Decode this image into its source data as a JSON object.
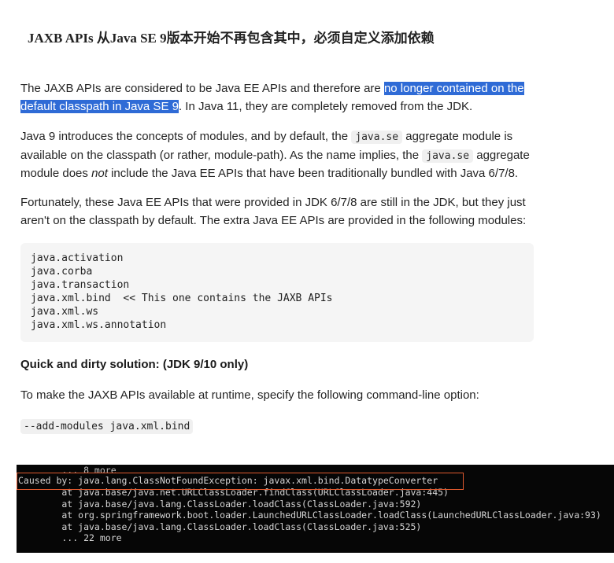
{
  "title": "JAXB APIs 从Java SE 9版本开始不再包含其中，必须自定义添加依赖",
  "p1": {
    "before": "The JAXB APIs are considered to be Java EE APIs and therefore are ",
    "highlight": "no longer contained on the default classpath in Java SE 9",
    "after": ". In Java 11, they are completely removed from the JDK."
  },
  "p2": {
    "t1": "Java 9 introduces the concepts of modules, and by default, the ",
    "code1": "java.se",
    "t2": " aggregate module is available on the classpath (or rather, module-path). As the name implies, the ",
    "code2": "java.se",
    "t3": " aggregate module does ",
    "em": "not",
    "t4": " include the Java EE APIs that have been traditionally bundled with Java 6/7/8."
  },
  "p3": "Fortunately, these Java EE APIs that were provided in JDK 6/7/8 are still in the JDK, but they just aren't on the classpath by default. The extra Java EE APIs are provided in the following modules:",
  "modules": [
    "java.activation",
    "java.corba",
    "java.transaction",
    "java.xml.bind  << This one contains the JAXB APIs",
    "java.xml.ws",
    "java.xml.ws.annotation"
  ],
  "heading2": "Quick and dirty solution: (JDK 9/10 only)",
  "p4": "To make the JAXB APIs available at runtime, specify the following command-line option:",
  "cmd": "--add-modules java.xml.bind",
  "terminal": [
    "        ... 8 more",
    "Caused by: java.lang.ClassNotFoundException: javax.xml.bind.DatatypeConverter",
    "        at java.base/java.net.URLClassLoader.findClass(URLClassLoader.java:445)",
    "        at java.base/java.lang.ClassLoader.loadClass(ClassLoader.java:592)",
    "        at org.springframework.boot.loader.LaunchedURLClassLoader.loadClass(LaunchedURLClassLoader.java:93)",
    "        at java.base/java.lang.ClassLoader.loadClass(ClassLoader.java:525)",
    "        ... 22 more"
  ]
}
